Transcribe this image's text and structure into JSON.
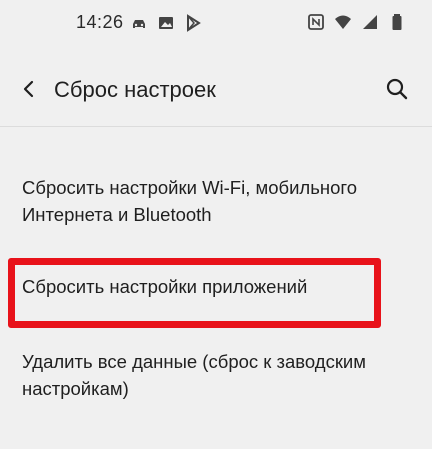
{
  "status_bar": {
    "time": "14:26",
    "left_icons": [
      "car-icon",
      "image-icon",
      "play-store-icon"
    ],
    "right_icons": [
      "nfc-icon",
      "wifi-icon",
      "signal-icon",
      "battery-icon"
    ]
  },
  "app_bar": {
    "title": "Сброс настроек",
    "back_icon": "chevron-left-icon",
    "search_icon": "search-icon"
  },
  "options": [
    {
      "label": "Сбросить настройки Wi-Fi, мобильного Интернета и Bluetooth"
    },
    {
      "label": "Сбросить настройки приложений",
      "highlighted": true
    },
    {
      "label": "Удалить все данные (сброс к заводским настройкам)"
    }
  ],
  "colors": {
    "background": "#f0f0f0",
    "highlight": "#e8121a",
    "text": "#1f1f1f"
  }
}
